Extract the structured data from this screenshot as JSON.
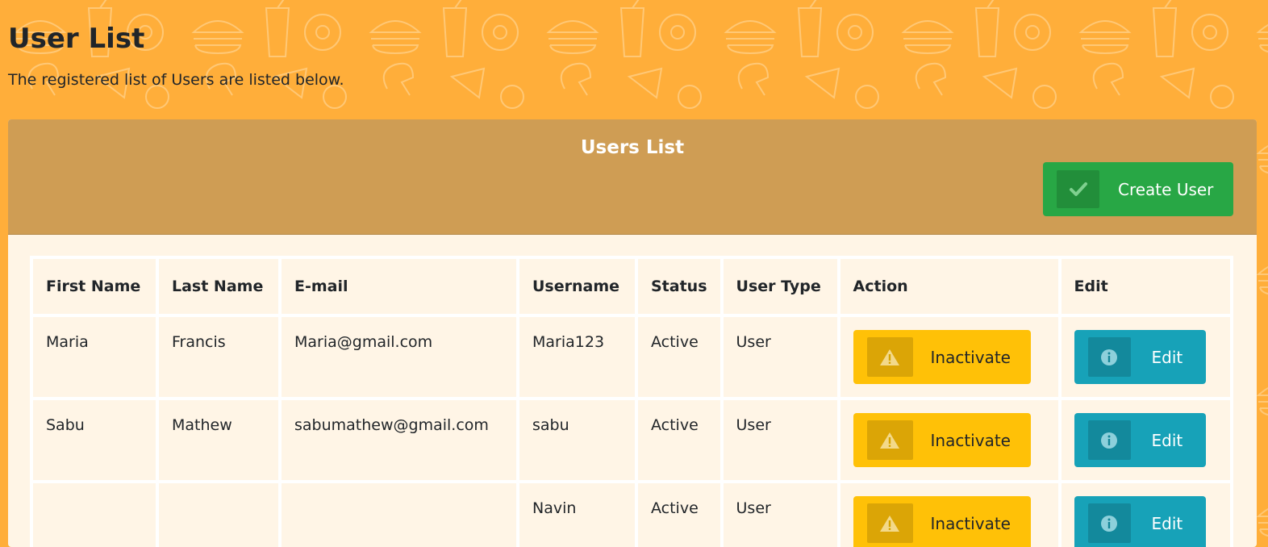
{
  "page": {
    "title": "User List",
    "subtitle": "The registered list of Users are listed below."
  },
  "card": {
    "title": "Users List",
    "create_button_label": "Create User"
  },
  "table": {
    "headers": [
      "First Name",
      "Last Name",
      "E-mail",
      "Username",
      "Status",
      "User Type",
      "Action",
      "Edit"
    ],
    "rows": [
      {
        "first_name": "Maria",
        "last_name": "Francis",
        "email": "Maria@gmail.com",
        "username": "Maria123",
        "status": "Active",
        "user_type": "User",
        "action_label": "Inactivate",
        "edit_label": "Edit"
      },
      {
        "first_name": "Sabu",
        "last_name": "Mathew",
        "email": "sabumathew@gmail.com",
        "username": "sabu",
        "status": "Active",
        "user_type": "User",
        "action_label": "Inactivate",
        "edit_label": "Edit"
      },
      {
        "first_name": "",
        "last_name": "",
        "email": "",
        "username": "Navin",
        "status": "Active",
        "user_type": "User",
        "action_label": "Inactivate",
        "edit_label": "Edit"
      }
    ]
  },
  "icons": {
    "create": "check-icon",
    "action": "warning-icon",
    "edit": "info-icon",
    "background": "food-pattern-icon"
  },
  "colors": {
    "background": "#ffae3a",
    "card_header": "#cf9d54",
    "card_body": "#fff5e6",
    "success": "#28a745",
    "warning": "#ffc107",
    "info": "#17a2b8"
  }
}
